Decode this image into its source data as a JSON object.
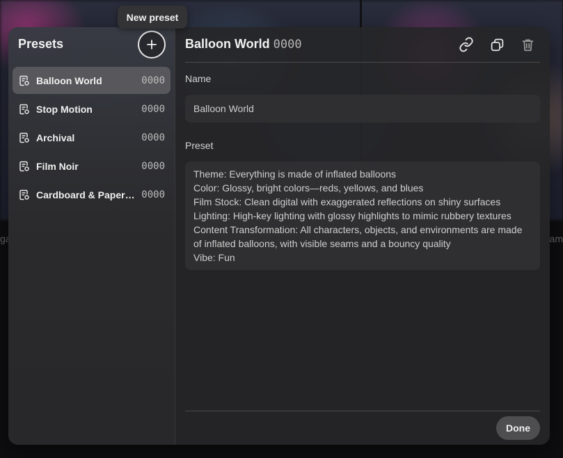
{
  "tooltip": {
    "text": "New preset"
  },
  "sidebar": {
    "title": "Presets",
    "new_preset_label": "New preset",
    "items": [
      {
        "name": "Balloon World",
        "count": "0000",
        "active": true
      },
      {
        "name": "Stop Motion",
        "count": "0000"
      },
      {
        "name": "Archival",
        "count": "0000"
      },
      {
        "name": "Film Noir",
        "count": "0000"
      },
      {
        "name": "Cardboard & Papercraft",
        "count": "0000"
      }
    ]
  },
  "main": {
    "title": "Balloon World",
    "count": "0000",
    "actions": {
      "link": "link-icon",
      "duplicate": "duplicate-icon",
      "delete": "trash-icon"
    },
    "name_label": "Name",
    "name_value": "Balloon World",
    "preset_label": "Preset",
    "preset_text": "Theme: Everything is made of inflated balloons\nColor: Glossy, bright colors—reds, yellows, and blues\nFilm Stock: Clean digital with exaggerated reflections on shiny surfaces\nLighting: High-key lighting with glossy highlights to mimic rubbery textures\nContent Transformation: All characters, objects, and environments are made of inflated balloons, with visible seams and a bouncy quality\nVibe: Fun",
    "done_label": "Done"
  },
  "background": {
    "left_text": "ga",
    "right_text": "am"
  }
}
